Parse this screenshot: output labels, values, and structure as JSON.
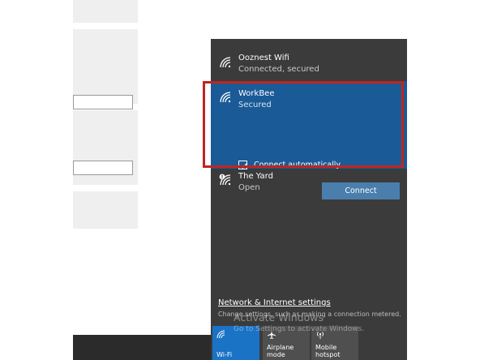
{
  "networks": [
    {
      "name": "Ooznest Wifi",
      "status": "Connected, secured"
    },
    {
      "name": "WorkBee",
      "status": "Secured"
    },
    {
      "name": "The Yard",
      "status": "Open"
    }
  ],
  "selected_network": {
    "checkbox_label": "Connect automatically",
    "checkbox_checked": true,
    "connect_label": "Connect"
  },
  "footer": {
    "settings_link": "Network & Internet settings",
    "settings_desc": "Change settings, such as making a connection metered."
  },
  "watermark": {
    "title": "Activate Windows",
    "subtitle": "Go to Settings to activate Windows."
  },
  "quick_actions": [
    {
      "label": "Wi-Fi",
      "icon": "wifi-icon",
      "active": true
    },
    {
      "label": "Airplane mode",
      "icon": "airplane-icon",
      "active": false
    },
    {
      "label": "Mobile hotspot",
      "icon": "hotspot-icon",
      "active": false
    }
  ],
  "colors": {
    "accent": "#1a5a96",
    "highlight_border": "#c0251e",
    "flyout_bg": "#3b3b3b"
  }
}
